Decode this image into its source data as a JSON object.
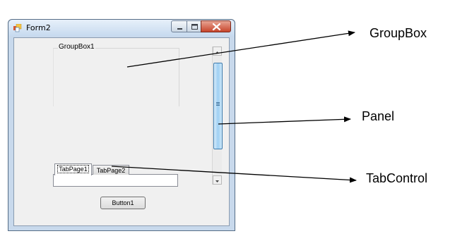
{
  "window": {
    "title": "Form2",
    "controls": {
      "minimize": "minimize-icon",
      "maximize": "maximize-icon",
      "close": "close-icon"
    }
  },
  "groupbox": {
    "label": "GroupBox1"
  },
  "tabcontrol": {
    "tabs": [
      {
        "label": "TabPage1"
      },
      {
        "label": "TabPage2"
      }
    ]
  },
  "button": {
    "label": "Button1"
  },
  "annotations": {
    "groupbox": "GroupBox",
    "panel": "Panel",
    "tabcontrol": "TabControl"
  },
  "colors": {
    "frame": "#c8d9ec",
    "client": "#f0f0f0",
    "close_button": "#c7452c",
    "scroll_thumb": "#9fd0f3"
  }
}
